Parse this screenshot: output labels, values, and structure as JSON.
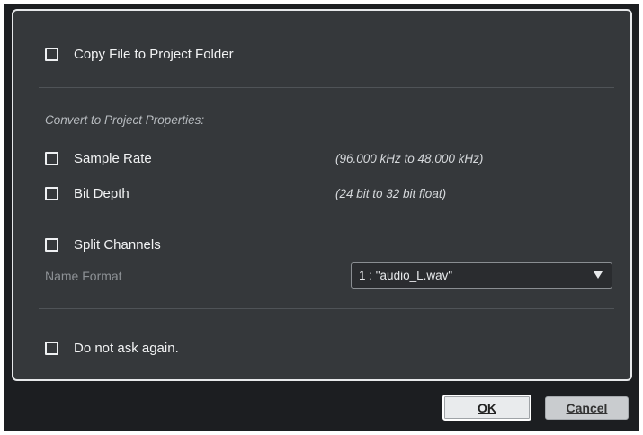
{
  "dialog": {
    "copy_file_label": "Copy File to Project Folder",
    "convert_section_label": "Convert to Project Properties:",
    "sample_rate_label": "Sample Rate",
    "sample_rate_info": "(96.000 kHz to 48.000 kHz)",
    "bit_depth_label": "Bit Depth",
    "bit_depth_info": "(24 bit to 32 bit float)",
    "split_channels_label": "Split Channels",
    "name_format_label": "Name Format",
    "name_format_value": "1 : \"audio_L.wav\"",
    "do_not_ask_label": "Do not ask again.",
    "checkboxes": {
      "copy_file": false,
      "sample_rate": false,
      "bit_depth": false,
      "split_channels": false,
      "do_not_ask": false
    }
  },
  "buttons": {
    "ok_label": "OK",
    "cancel_label": "Cancel"
  },
  "colors": {
    "window_bg": "#1c1e21",
    "panel_bg": "#35383b",
    "panel_border": "#e6e8ea",
    "text": "#f2f3f4"
  }
}
